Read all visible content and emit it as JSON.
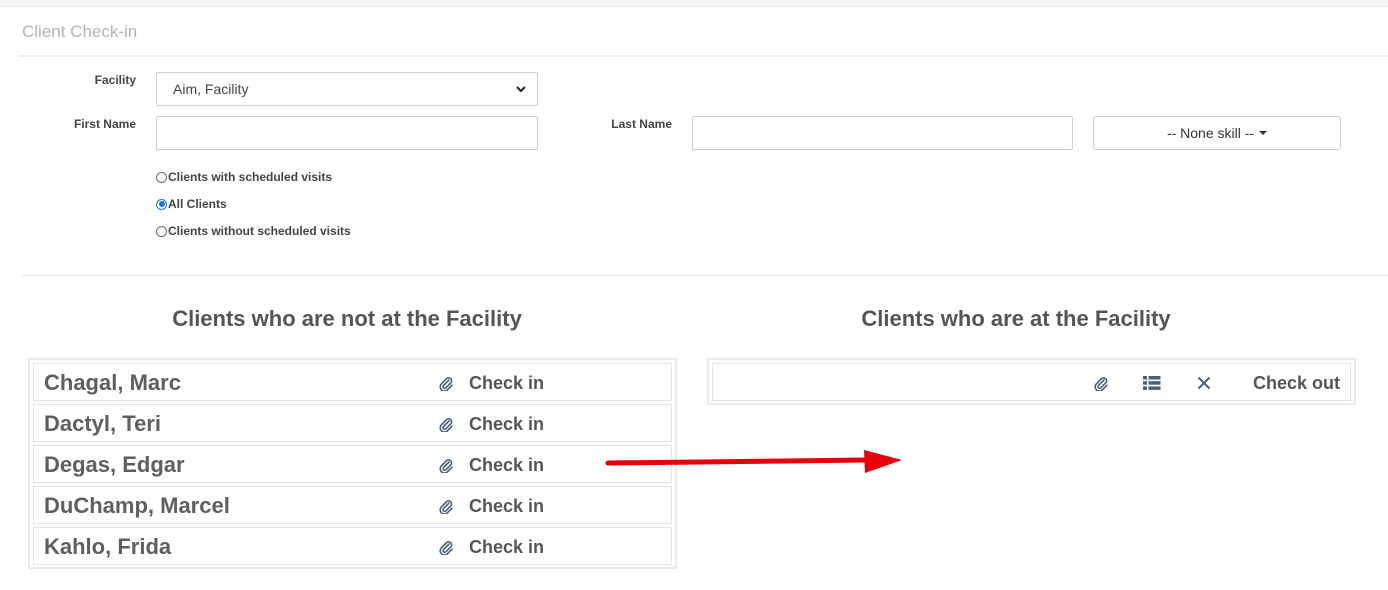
{
  "panel": {
    "title": "Client Check-in"
  },
  "form": {
    "facility_label": "Facility",
    "facility_value": "Aim, Facility",
    "first_name_label": "First Name",
    "first_name_value": "",
    "last_name_label": "Last Name",
    "last_name_value": "",
    "skill_label": "-- None skill --",
    "radios": [
      {
        "label": "Clients with scheduled visits",
        "checked": false
      },
      {
        "label": "All Clients",
        "checked": true
      },
      {
        "label": "Clients without scheduled visits",
        "checked": false
      }
    ]
  },
  "not_at_facility": {
    "heading": "Clients who are not at the Facility",
    "action_label": "Check in",
    "clients": [
      {
        "name": "Chagal, Marc"
      },
      {
        "name": "Dactyl, Teri"
      },
      {
        "name": "Degas, Edgar"
      },
      {
        "name": "DuChamp, Marcel"
      },
      {
        "name": "Kahlo, Frida"
      }
    ]
  },
  "at_facility": {
    "heading": "Clients who are at the Facility",
    "action_label": "Check out"
  },
  "colors": {
    "annotation_arrow": "#e8000b",
    "radio_accent": "#1a73e8",
    "icon": "#4a6079"
  },
  "icons": [
    "paperclip-icon",
    "list-icon",
    "close-icon",
    "chevron-down-icon",
    "caret-down-icon"
  ]
}
